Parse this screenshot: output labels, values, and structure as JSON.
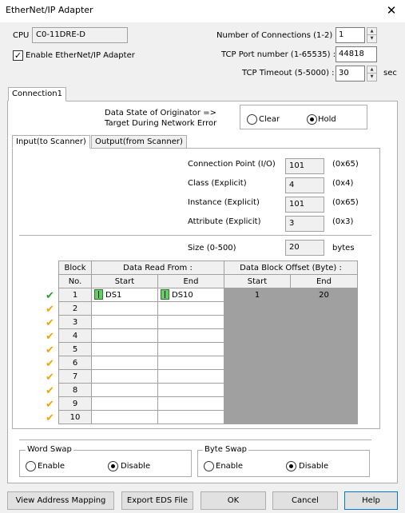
{
  "title": "EtherNet/IP Adapter",
  "cpu": {
    "label": "CPU",
    "value": "C0-11DRE-D"
  },
  "enable": {
    "label": "Enable EtherNet/IP Adapter",
    "checked": true
  },
  "connections": {
    "label": "Number of Connections (1-2) :",
    "value": "1"
  },
  "tcp_port": {
    "label": "TCP Port number (1-65535) :",
    "value": "44818"
  },
  "tcp_timeout": {
    "label": "TCP Timeout (5-5000) :",
    "value": "30",
    "unit": "sec"
  },
  "conn_tab": "Connection1",
  "data_state": {
    "line1": "Data State of Originator =>",
    "line2": "Target During Network Error",
    "clear": "Clear",
    "hold": "Hold"
  },
  "io_tabs": {
    "input": "Input(to Scanner)",
    "output": "Output(from Scanner)"
  },
  "fields": [
    {
      "label": "Connection Point (I/O)",
      "value": "101",
      "hex": "(0x65)"
    },
    {
      "label": "Class (Explicit)",
      "value": "4",
      "hex": "(0x4)"
    },
    {
      "label": "Instance (Explicit)",
      "value": "101",
      "hex": "(0x65)"
    },
    {
      "label": "Attribute (Explicit)",
      "value": "3",
      "hex": "(0x3)"
    }
  ],
  "size": {
    "label": "Size (0-500)",
    "value": "20",
    "unit": "bytes"
  },
  "table": {
    "h_block": "Block",
    "h_no": "No.",
    "h_read": "Data Read From :",
    "h_offset": "Data Block Offset (Byte) :",
    "h_start": "Start",
    "h_end": "End",
    "h_ostart": "Start",
    "h_oend": "End",
    "rows": [
      {
        "no": "1",
        "start": "DS1",
        "end": "DS10",
        "ostart": "1",
        "oend": "20"
      },
      {
        "no": "2",
        "start": "",
        "end": "",
        "ostart": "",
        "oend": ""
      },
      {
        "no": "3",
        "start": "",
        "end": "",
        "ostart": "",
        "oend": ""
      },
      {
        "no": "4",
        "start": "",
        "end": "",
        "ostart": "",
        "oend": ""
      },
      {
        "no": "5",
        "start": "",
        "end": "",
        "ostart": "",
        "oend": ""
      },
      {
        "no": "6",
        "start": "",
        "end": "",
        "ostart": "",
        "oend": ""
      },
      {
        "no": "7",
        "start": "",
        "end": "",
        "ostart": "",
        "oend": ""
      },
      {
        "no": "8",
        "start": "",
        "end": "",
        "ostart": "",
        "oend": ""
      },
      {
        "no": "9",
        "start": "",
        "end": "",
        "ostart": "",
        "oend": ""
      },
      {
        "no": "10",
        "start": "",
        "end": "",
        "ostart": "",
        "oend": ""
      }
    ]
  },
  "word_swap": {
    "title": "Word Swap",
    "enable": "Enable",
    "disable": "Disable"
  },
  "byte_swap": {
    "title": "Byte Swap",
    "enable": "Enable",
    "disable": "Disable"
  },
  "buttons": {
    "view": "View Address Mapping",
    "export": "Export EDS File",
    "ok": "OK",
    "cancel": "Cancel",
    "help": "Help"
  },
  "colors": {
    "check_green": "#2e9e2e",
    "check_yellow": "#e8a800",
    "grid_gray": "#a0a0a0",
    "io_green": "#66cc66"
  }
}
